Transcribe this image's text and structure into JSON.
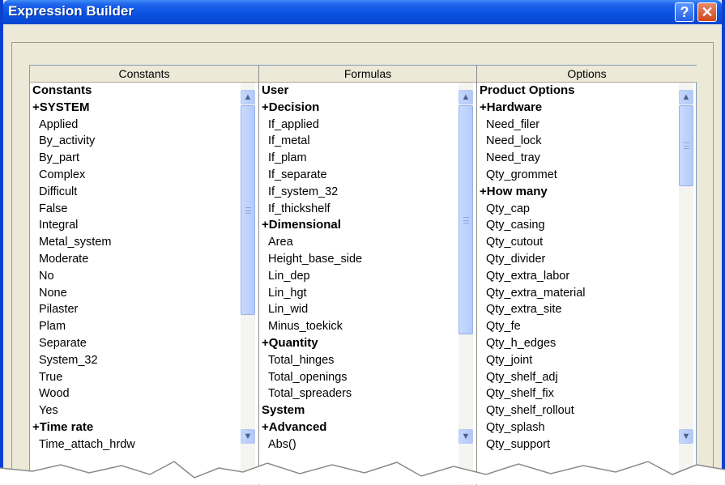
{
  "window": {
    "title": "Expression Builder",
    "help_label": "?",
    "close_label": "✕"
  },
  "columns": [
    {
      "header": "Constants",
      "items": [
        {
          "label": "Constants",
          "bold": true
        },
        {
          "label": "+SYSTEM",
          "bold": true
        },
        {
          "label": "Applied"
        },
        {
          "label": "By_activity"
        },
        {
          "label": "By_part"
        },
        {
          "label": "Complex"
        },
        {
          "label": "Difficult"
        },
        {
          "label": "False"
        },
        {
          "label": "Integral"
        },
        {
          "label": "Metal_system"
        },
        {
          "label": "Moderate"
        },
        {
          "label": "No"
        },
        {
          "label": "None"
        },
        {
          "label": "Pilaster"
        },
        {
          "label": "Plam"
        },
        {
          "label": "Separate"
        },
        {
          "label": "System_32"
        },
        {
          "label": "True"
        },
        {
          "label": "Wood"
        },
        {
          "label": "Yes"
        },
        {
          "label": "+Time rate",
          "bold": true
        },
        {
          "label": "Time_attach_hrdw"
        }
      ],
      "scroll_thumb_position": 0.0,
      "scroll_thumb_fraction": 0.65
    },
    {
      "header": "Formulas",
      "items": [
        {
          "label": "User",
          "bold": true
        },
        {
          "label": "+Decision",
          "bold": true
        },
        {
          "label": "If_applied"
        },
        {
          "label": "If_metal"
        },
        {
          "label": "If_plam"
        },
        {
          "label": "If_separate"
        },
        {
          "label": "If_system_32"
        },
        {
          "label": "If_thickshelf"
        },
        {
          "label": "+Dimensional",
          "bold": true
        },
        {
          "label": "Area"
        },
        {
          "label": "Height_base_side"
        },
        {
          "label": "Lin_dep"
        },
        {
          "label": "Lin_hgt"
        },
        {
          "label": "Lin_wid"
        },
        {
          "label": "Minus_toekick"
        },
        {
          "label": "+Quantity",
          "bold": true
        },
        {
          "label": "Total_hinges"
        },
        {
          "label": "Total_openings"
        },
        {
          "label": "Total_spreaders"
        },
        {
          "label": "System",
          "bold": true
        },
        {
          "label": "+Advanced",
          "bold": true
        },
        {
          "label": "Abs()"
        }
      ],
      "scroll_thumb_position": 0.0,
      "scroll_thumb_fraction": 0.71
    },
    {
      "header": "Options",
      "items": [
        {
          "label": "Product Options",
          "bold": true
        },
        {
          "label": "+Hardware",
          "bold": true
        },
        {
          "label": "Need_filer"
        },
        {
          "label": "Need_lock"
        },
        {
          "label": "Need_tray"
        },
        {
          "label": "Qty_grommet"
        },
        {
          "label": "+How many",
          "bold": true
        },
        {
          "label": "Qty_cap"
        },
        {
          "label": "Qty_casing"
        },
        {
          "label": "Qty_cutout"
        },
        {
          "label": "Qty_divider"
        },
        {
          "label": "Qty_extra_labor"
        },
        {
          "label": "Qty_extra_material"
        },
        {
          "label": "Qty_extra_site"
        },
        {
          "label": "Qty_fe"
        },
        {
          "label": "Qty_h_edges"
        },
        {
          "label": "Qty_joint"
        },
        {
          "label": "Qty_shelf_adj"
        },
        {
          "label": "Qty_shelf_fix"
        },
        {
          "label": "Qty_shelf_rollout"
        },
        {
          "label": "Qty_splash"
        },
        {
          "label": "Qty_support"
        }
      ],
      "scroll_thumb_position": 0.0,
      "scroll_thumb_fraction": 0.25
    }
  ],
  "colors": {
    "titlebar": "#0a52e2",
    "dialog_bg": "#ece9d8",
    "list_bg": "#ffffff",
    "close_button": "#d2461c"
  },
  "icons": {
    "scroll_up": "chevron-up-icon",
    "scroll_down": "chevron-down-icon",
    "help": "question-mark-icon",
    "close": "close-icon"
  }
}
